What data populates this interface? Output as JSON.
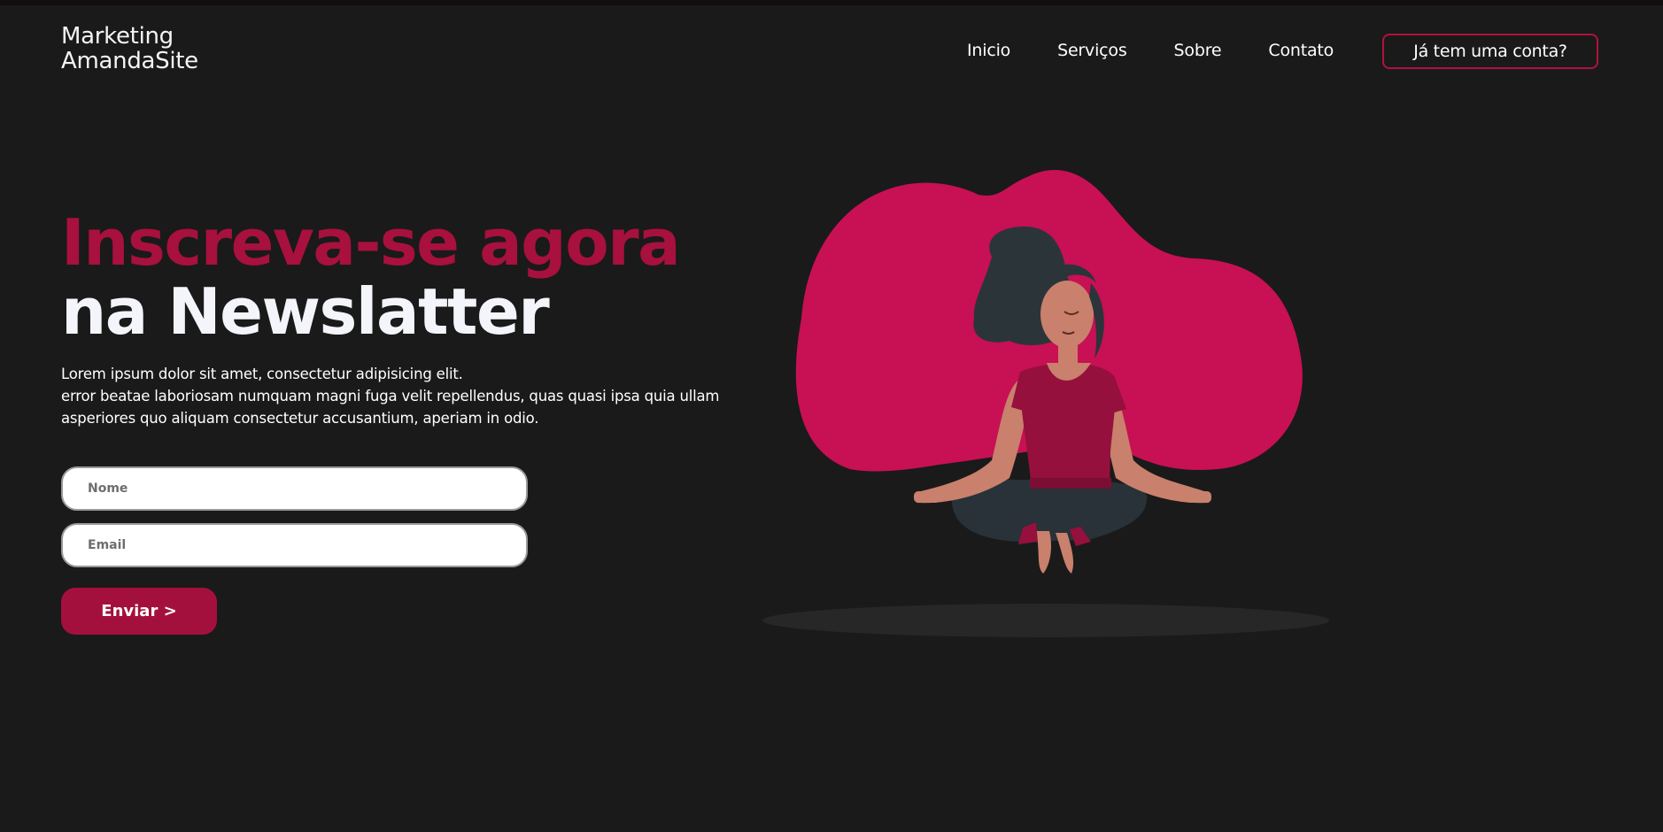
{
  "header": {
    "logo_line1": "Marketing",
    "logo_line2": "AmandaSite",
    "nav": [
      "Inicio",
      "Serviços",
      "Sobre",
      "Contato"
    ],
    "account_button": "Já tem uma conta?"
  },
  "hero": {
    "title_line1": "Inscreva-se agora",
    "title_line2": "na Newslatter",
    "lead_line1": "Lorem ipsum dolor sit amet, consectetur adipisicing elit.",
    "lead_line2": "error beatae laboriosam numquam magni fuga velit repellendus, quas quasi ipsa quia ullam",
    "lead_line3": "asperiores quo aliquam consectetur accusantium, aperiam in odio."
  },
  "form": {
    "name_placeholder": "Nome",
    "email_placeholder": "Email",
    "submit_label": "Enviar >"
  },
  "colors": {
    "background": "#1a1a1a",
    "accent": "#a8103e",
    "blob": "#c81054",
    "title_light": "#f3f5fa"
  },
  "illustration": "meditating-woman"
}
